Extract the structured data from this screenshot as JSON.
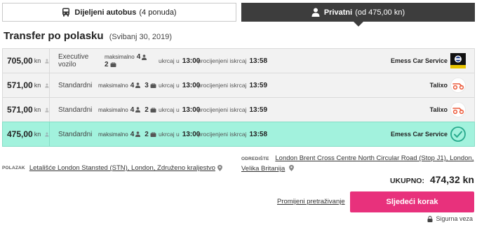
{
  "tabs": {
    "shared": {
      "label": "Dijeljeni autobus",
      "sub": "(4 ponuda)",
      "icon": "bus-icon"
    },
    "private": {
      "label": "Privatni",
      "sub": "(od 475,00 kn)",
      "icon": "user-icon"
    }
  },
  "heading": {
    "title": "Transfer po polasku",
    "date": "(Svibanj 30, 2019)"
  },
  "rows": [
    {
      "price": "705,00",
      "currency": "kn",
      "vehicle_line1": "Executive",
      "vehicle_line2": "vozilo",
      "max_label": "maksimalno",
      "passengers": "4",
      "luggage": "2",
      "pickup_label": "ukrcaj u",
      "pickup_time": "13:00",
      "dropoff_label": "procijenjeni iskrcaj",
      "dropoff_time": "13:58",
      "provider": "Emess Car Service"
    },
    {
      "price": "571,00",
      "currency": "kn",
      "vehicle": "Standardni",
      "max_label": "maksimalno",
      "passengers": "4",
      "luggage": "3",
      "pickup_label": "ukrcaj u",
      "pickup_time": "13:00",
      "dropoff_label": "procijenjeni iskrcaj",
      "dropoff_time": "13:59",
      "provider": "Talixo"
    },
    {
      "price": "571,00",
      "currency": "kn",
      "vehicle": "Standardni",
      "max_label": "maksimalno",
      "passengers": "4",
      "luggage": "2",
      "pickup_label": "ukrcaj u",
      "pickup_time": "13:00",
      "dropoff_label": "procijenjeni iskrcaj",
      "dropoff_time": "13:59",
      "provider": "Talixo"
    },
    {
      "price": "475,00",
      "currency": "kn",
      "vehicle": "Standardni",
      "max_label": "maksimalno",
      "passengers": "4",
      "luggage": "2",
      "pickup_label": "ukrcaj u",
      "pickup_time": "13:00",
      "dropoff_label": "procijenjeni iskrcaj",
      "dropoff_time": "13:58",
      "provider": "Emess Car Service"
    }
  ],
  "route": {
    "from_tag": "POLAZAK",
    "from": "Letališće London Stansted (STN), London, Združeno kraljestvo",
    "to_tag": "ODREDIŠTE",
    "to": "London Brent Cross Centre North Circular Road (Stop J1), London, Velika Britanija"
  },
  "total": {
    "label": "UKUPNO:",
    "value": "474,32 kn"
  },
  "actions": {
    "change": "Promijeni pretraživanje",
    "next": "Sljedeći korak",
    "secure": "Sigurna veza"
  },
  "colors": {
    "selected_row": "#a2f2dd",
    "accent_pink": "#e8317c",
    "check_teal": "#27a98c",
    "talixo_orange": "#ec5a3a",
    "dark_tab": "#3d3d3d"
  }
}
